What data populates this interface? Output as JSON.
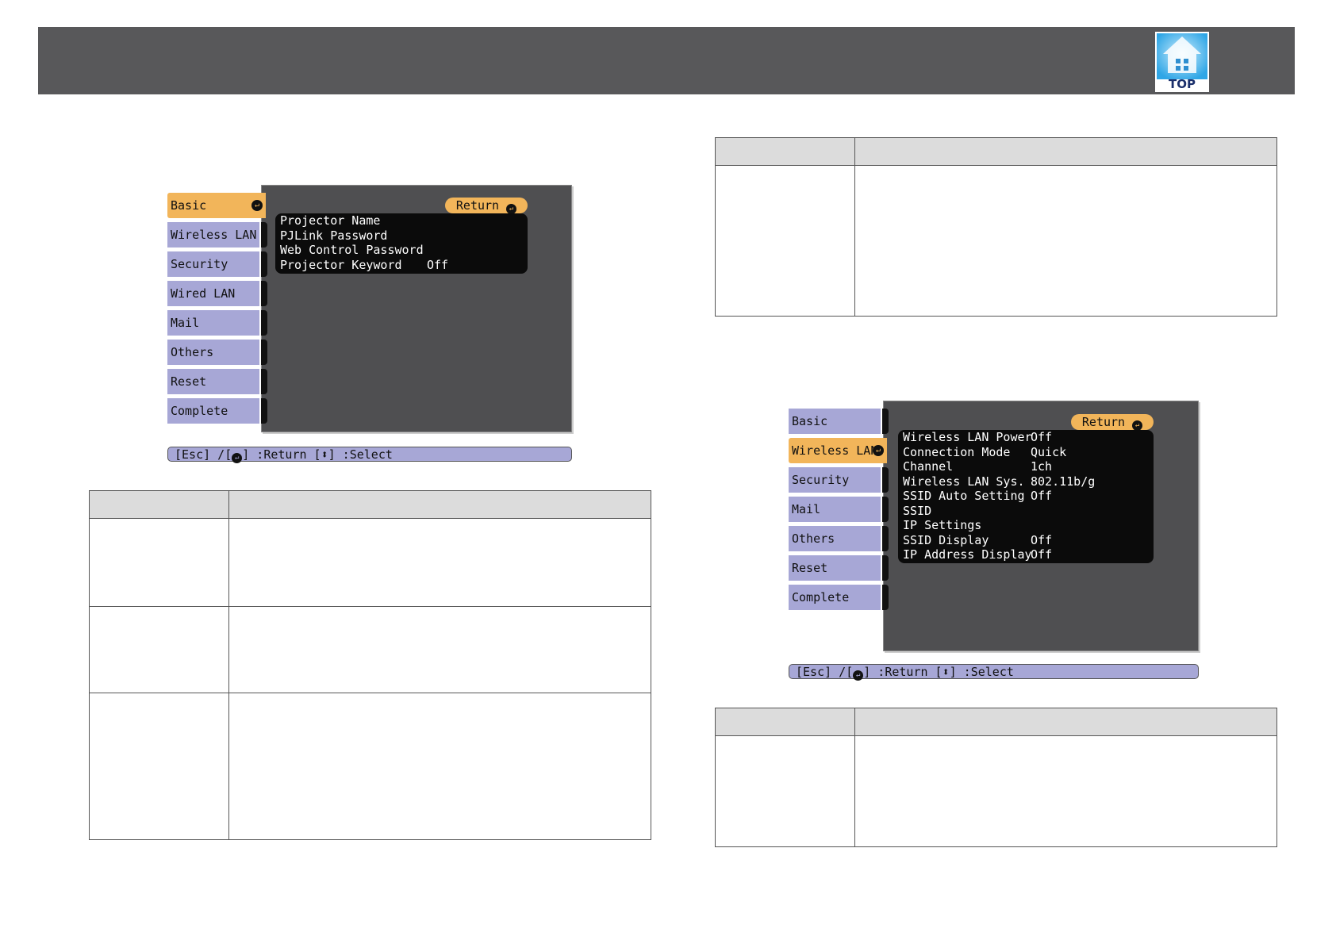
{
  "header": {
    "top_label": "TOP",
    "top_icon": "home-icon"
  },
  "menu_basic": {
    "tabs": [
      {
        "label": "Basic",
        "active": true
      },
      {
        "label": "Wireless LAN",
        "active": false
      },
      {
        "label": "Security",
        "active": false
      },
      {
        "label": "Wired LAN",
        "active": false
      },
      {
        "label": "Mail",
        "active": false
      },
      {
        "label": "Others",
        "active": false
      },
      {
        "label": "Reset",
        "active": false
      },
      {
        "label": "Complete",
        "active": false
      }
    ],
    "return_label": "Return",
    "rows": [
      {
        "key": "Projector Name",
        "value": ""
      },
      {
        "key": "PJLink Password",
        "value": ""
      },
      {
        "key": "Web Control Password",
        "value": ""
      },
      {
        "key": "Projector Keyword",
        "value": "Off"
      }
    ],
    "status": {
      "esc": "[Esc] /[",
      "return_text": "] :Return  [",
      "select_text": "] :Select"
    }
  },
  "menu_wireless": {
    "tabs": [
      {
        "label": "Basic",
        "active": false
      },
      {
        "label": "Wireless LAN",
        "active": true
      },
      {
        "label": "Security",
        "active": false
      },
      {
        "label": "Mail",
        "active": false
      },
      {
        "label": "Others",
        "active": false
      },
      {
        "label": "Reset",
        "active": false
      },
      {
        "label": "Complete",
        "active": false
      }
    ],
    "return_label": "Return",
    "rows": [
      {
        "key": "Wireless LAN Power",
        "value": "Off"
      },
      {
        "key": "Connection Mode",
        "value": "Quick"
      },
      {
        "key": "Channel",
        "value": "1ch"
      },
      {
        "key": "Wireless LAN Sys.",
        "value": "802.11b/g"
      },
      {
        "key": "SSID Auto Setting",
        "value": "Off"
      },
      {
        "key": "SSID",
        "value": ""
      },
      {
        "key": "IP Settings",
        "value": ""
      },
      {
        "key": "SSID Display",
        "value": "Off"
      },
      {
        "key": "IP Address Display",
        "value": "Off"
      }
    ],
    "status": {
      "esc": "[Esc] /[",
      "return_text": "] :Return  [",
      "select_text": "] :Select"
    }
  },
  "colors": {
    "header_bar": "#58585a",
    "tab_inactive": "#a7a7d6",
    "tab_active": "#f2b55a",
    "panel_bg": "#4f4f51",
    "table_header": "#dcdcdc"
  },
  "icons": {
    "enter": "enter-icon",
    "updown": "up-down-arrow-icon"
  }
}
